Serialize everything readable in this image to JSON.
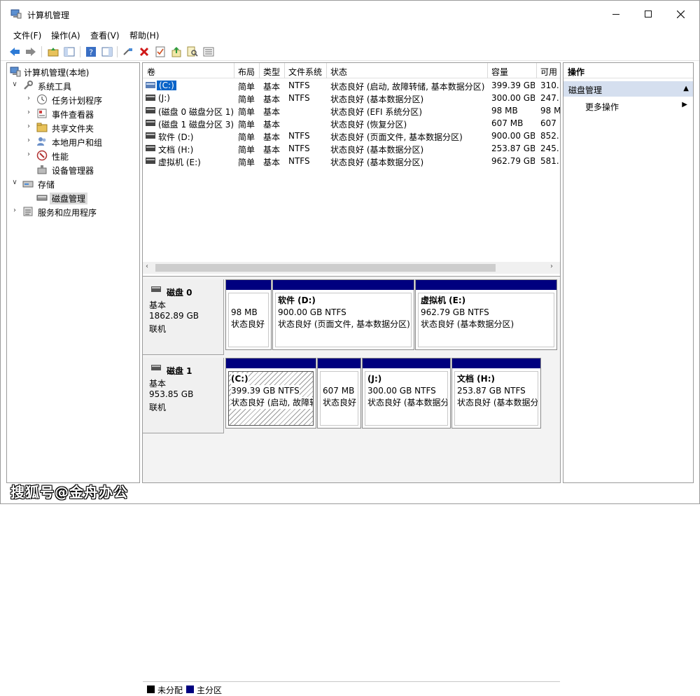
{
  "window": {
    "title": "计算机管理"
  },
  "menu": [
    "文件(F)",
    "操作(A)",
    "查看(V)",
    "帮助(H)"
  ],
  "tree": {
    "root": "计算机管理(本地)",
    "system_tools": "系统工具",
    "task_scheduler": "任务计划程序",
    "event_viewer": "事件查看器",
    "shared_folders": "共享文件夹",
    "local_users": "本地用户和组",
    "performance": "性能",
    "device_manager": "设备管理器",
    "storage": "存储",
    "disk_management": "磁盘管理",
    "services_apps": "服务和应用程序"
  },
  "volume_table": {
    "headers": [
      "卷",
      "布局",
      "类型",
      "文件系统",
      "状态",
      "容量",
      "可用"
    ],
    "rows": [
      [
        "(C:)",
        "简单",
        "基本",
        "NTFS",
        "状态良好 (启动, 故障转储, 基本数据分区)",
        "399.39 GB",
        "310."
      ],
      [
        "(J:)",
        "简单",
        "基本",
        "NTFS",
        "状态良好 (基本数据分区)",
        "300.00 GB",
        "247."
      ],
      [
        "(磁盘 0 磁盘分区 1)",
        "简单",
        "基本",
        "",
        "状态良好 (EFI 系统分区)",
        "98 MB",
        "98 M"
      ],
      [
        "(磁盘 1 磁盘分区 3)",
        "简单",
        "基本",
        "",
        "状态良好 (恢复分区)",
        "607 MB",
        "607"
      ],
      [
        "软件 (D:)",
        "简单",
        "基本",
        "NTFS",
        "状态良好 (页面文件, 基本数据分区)",
        "900.00 GB",
        "852."
      ],
      [
        "文档 (H:)",
        "简单",
        "基本",
        "NTFS",
        "状态良好 (基本数据分区)",
        "253.87 GB",
        "245."
      ],
      [
        "虚拟机 (E:)",
        "简单",
        "基本",
        "NTFS",
        "状态良好 (基本数据分区)",
        "962.79 GB",
        "581."
      ]
    ]
  },
  "disks": [
    {
      "name": "磁盘 0",
      "type": "基本",
      "size": "1862.89 GB",
      "status": "联机",
      "partitions": [
        {
          "name": "",
          "size": "98 MB",
          "status": "状态良好"
        },
        {
          "name": "软件  (D:)",
          "size": "900.00 GB NTFS",
          "status": "状态良好 (页面文件, 基本数据分区)"
        },
        {
          "name": "虚拟机  (E:)",
          "size": "962.79 GB NTFS",
          "status": "状态良好 (基本数据分区)"
        }
      ]
    },
    {
      "name": "磁盘 1",
      "type": "基本",
      "size": "953.85 GB",
      "status": "联机",
      "partitions": [
        {
          "name": "(C:)",
          "size": "399.39 GB NTFS",
          "status": "状态良好 (启动, 故障转储"
        },
        {
          "name": "",
          "size": "607 MB",
          "status": "状态良好"
        },
        {
          "name": "(J:)",
          "size": "300.00 GB NTFS",
          "status": "状态良好 (基本数据分区)"
        },
        {
          "name": "文档  (H:)",
          "size": "253.87 GB NTFS",
          "status": "状态良好 (基本数据分区)"
        }
      ]
    }
  ],
  "legend": {
    "unallocated": "未分配",
    "primary": "主分区"
  },
  "actions": {
    "header": "操作",
    "section": "磁盘管理",
    "more": "更多操作"
  },
  "watermark": "搜狐号@金舟办公",
  "colors": {
    "partition_bar": "#00007f",
    "action_section": "#d5dfef"
  }
}
